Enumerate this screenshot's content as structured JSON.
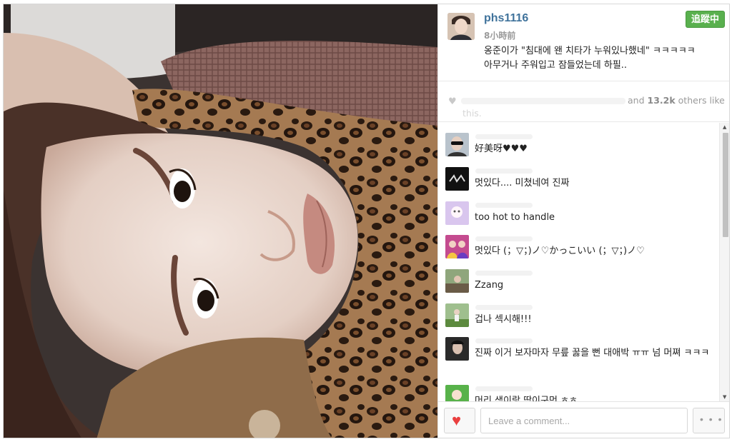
{
  "post": {
    "username": "phs1116",
    "timestamp": "8小時前",
    "follow_label": "追蹤中",
    "caption_line1": "옹준이가 \"침대에 왠 치타가 누워있나했네\" ㅋㅋㅋㅋㅋ",
    "caption_line2": "아무거나 주워입고 잠들었는데 하필.."
  },
  "likes": {
    "and": "and",
    "count": "13.2k",
    "others": "others like",
    "suffix": "this."
  },
  "comments": [
    {
      "text": "好美呀♥♥♥",
      "avatar": "sunglasses"
    },
    {
      "text": "멋있다.... 미쳤네여 진짜",
      "avatar": "dark-logo"
    },
    {
      "text": "too hot to handle",
      "avatar": "lilac-sticker"
    },
    {
      "text": "멋있다 (；▽；)ノ♡かっこいい (；▽；)ノ♡",
      "avatar": "girl-group"
    },
    {
      "text": "Zzang",
      "avatar": "outdoor"
    },
    {
      "text": "겁나 섹시해!!!",
      "avatar": "field"
    },
    {
      "text": "진짜 이거 보자마자 무릎 꿇을 뻔 대애박 ㅠㅠ 넘 머쪄 ㅋㅋㅋ",
      "avatar": "dark-portrait"
    },
    {
      "text": "머리 색이랑 딱이구먼 ㅎㅎ",
      "avatar": "green-sticker"
    }
  ],
  "footer": {
    "comment_placeholder": "Leave a comment...",
    "more_label": "• • •"
  },
  "colors": {
    "username": "#3f729b",
    "follow_green": "#59b04e",
    "like_red": "#ea3f3f"
  }
}
